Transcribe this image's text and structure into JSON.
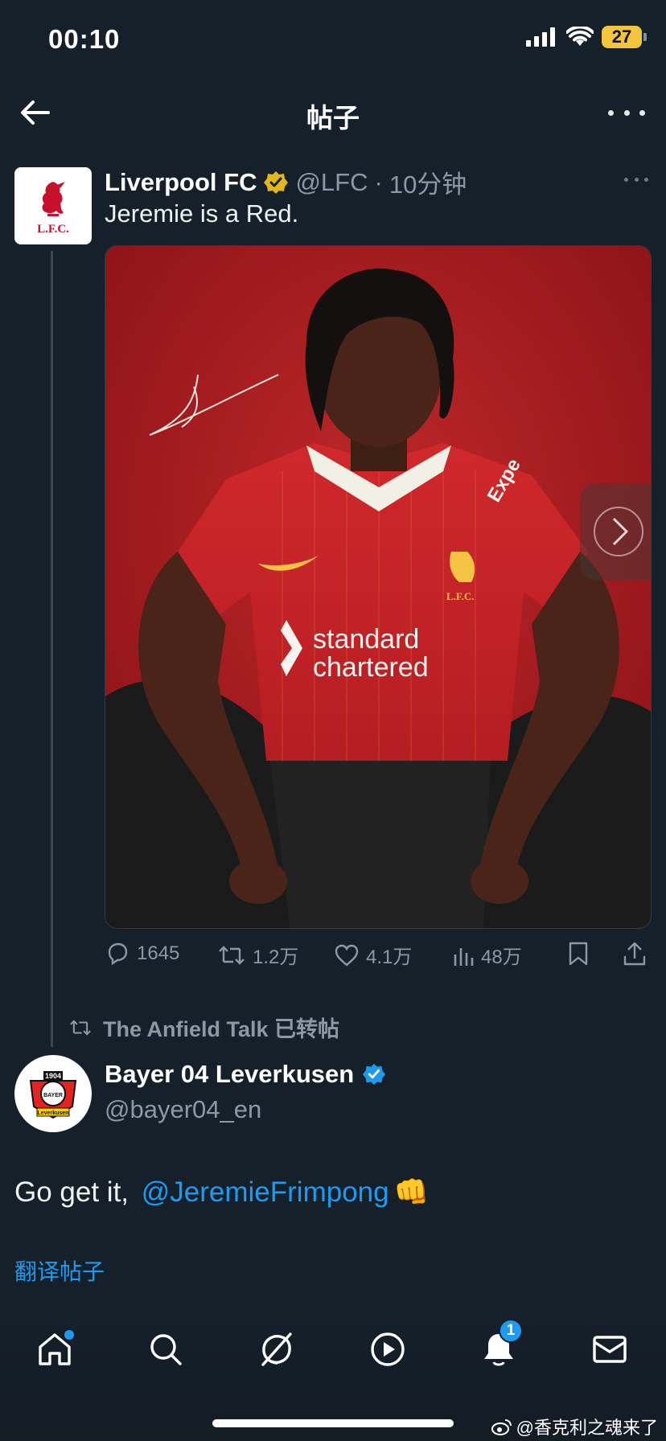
{
  "status_bar": {
    "time": "00:10",
    "battery": "27",
    "icons": [
      "cellular-signal-icon",
      "wifi-icon",
      "battery-icon"
    ]
  },
  "topnav": {
    "title": "帖子",
    "icons": [
      "back-arrow-icon",
      "more-horizontal-icon"
    ]
  },
  "tweet1": {
    "display_name": "Liverpool FC",
    "handle": "@LFC",
    "separator": "·",
    "time": "10分钟",
    "text": "Jeremie is a Red.",
    "avatar_text": "L.F.C.",
    "media": {
      "jersey_sponsor_line1": "standard",
      "jersey_sponsor_line2": "chartered",
      "jersey_crest": "L.F.C.",
      "sleeve_text": "Expe"
    },
    "stats": {
      "replies": "1645",
      "retweets": "1.2万",
      "likes": "4.1万",
      "views": "48万"
    },
    "colors": {
      "verified_gold": "#e2b719",
      "lfc_red": "#c8102e"
    }
  },
  "retweet_context": {
    "text": "The Anfield Talk 已转帖"
  },
  "tweet2": {
    "display_name": "Bayer 04 Leverkusen",
    "handle": "@bayer04_en",
    "text_prefix": "Go get it, ",
    "mention": "@JeremieFrimpong",
    "emoji": "👊",
    "translate": "翻译帖子",
    "avatar_text_top": "1904",
    "avatar_text_mid": "BAYER",
    "avatar_text_bottom": "Leverkusen",
    "colors": {
      "verified_blue": "#1d9bf0",
      "link": "#1d9bf0"
    }
  },
  "bottom_nav": {
    "items": [
      "home-icon",
      "search-icon",
      "grok-icon",
      "video-play-icon",
      "notifications-bell-icon",
      "messages-mail-icon"
    ],
    "notif_count": "1"
  },
  "watermark": "@香克利之魂来了"
}
